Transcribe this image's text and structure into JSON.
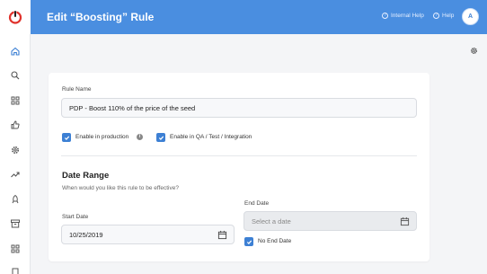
{
  "header": {
    "title": "Edit “Boosting” Rule",
    "internal_help": "Internal Help",
    "help": "Help",
    "avatar_initial": "A"
  },
  "sidebar": {
    "items": [
      "home-icon",
      "search-icon",
      "grid-icon",
      "thumbs-up-icon",
      "gear-icon",
      "trending-icon",
      "rocket-icon",
      "archive-icon",
      "apps-icon",
      "document-icon"
    ]
  },
  "form": {
    "rule_name_label": "Rule Name",
    "rule_name_value": "PDP - Boost 110% of the price of the seed",
    "enable_production_label": "Enable in production",
    "enable_production_checked": true,
    "enable_qa_label": "Enable in QA / Test / Integration",
    "enable_qa_checked": true,
    "date_range_title": "Date Range",
    "date_range_subtitle": "When would you like this rule to be effective?",
    "start_date_label": "Start Date",
    "start_date_value": "10/25/2019",
    "end_date_label": "End Date",
    "end_date_placeholder": "Select a date",
    "no_end_date_label": "No End Date",
    "no_end_date_checked": true
  },
  "colors": {
    "header": "#4a8ee0",
    "accent": "#3d80d4",
    "logo_red": "#e0322c"
  }
}
